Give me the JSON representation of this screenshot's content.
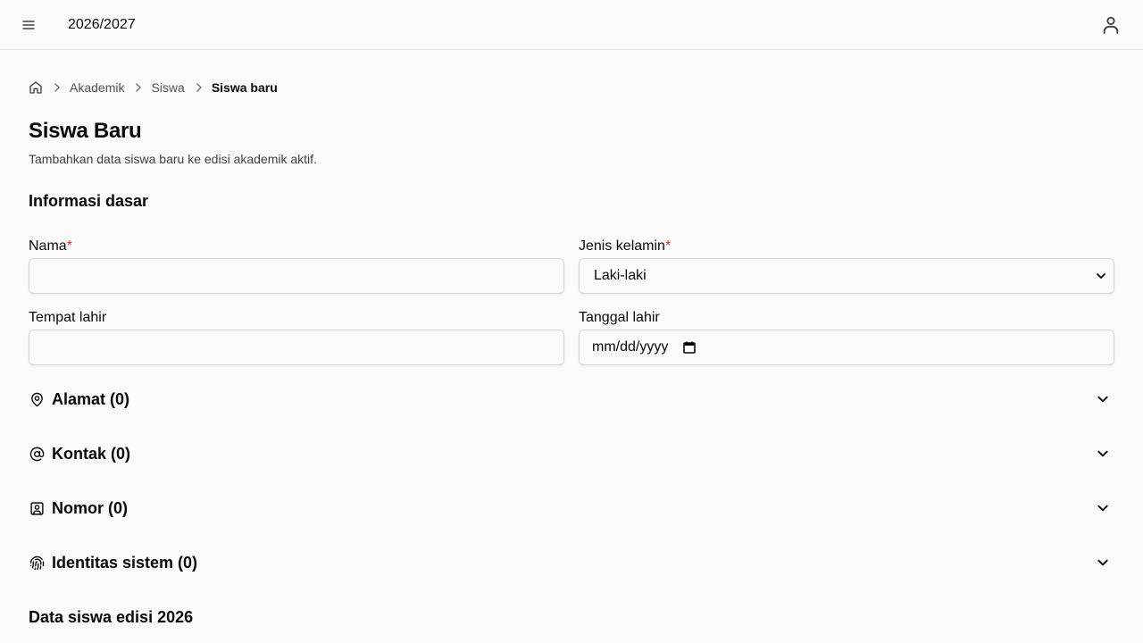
{
  "header": {
    "edition": "2026/2027",
    "menu_icon": "hamburger-icon",
    "user_icon": "user-icon"
  },
  "breadcrumb": {
    "home_icon": "home-icon",
    "items": [
      "Akademik",
      "Siswa"
    ],
    "current": "Siswa baru"
  },
  "page": {
    "title": "Siswa Baru",
    "description": "Tambahkan data siswa baru ke edisi akademik aktif."
  },
  "basic_info": {
    "title": "Informasi dasar",
    "name_label": "Nama",
    "name_value": "",
    "gender_label": "Jenis kelamin",
    "gender_value": "Laki-laki",
    "birthplace_label": "Tempat lahir",
    "birthplace_value": "",
    "birthdate_label": "Tanggal lahir",
    "birthdate_placeholder": "mm/dd/yyyy",
    "required_mark": "*"
  },
  "sections": [
    {
      "label": "Alamat (0)",
      "icon": "map-pin-icon"
    },
    {
      "label": "Kontak (0)",
      "icon": "at-sign-icon"
    },
    {
      "label": "Nomor (0)",
      "icon": "contact-card-icon"
    },
    {
      "label": "Identitas sistem (0)",
      "icon": "fingerprint-icon"
    }
  ],
  "edition_section": {
    "title": "Data siswa edisi 2026"
  },
  "colors": {
    "background": "#fafafa",
    "border": "#e5e5e5",
    "required": "#dc2626",
    "text": "#0a0a0a"
  }
}
